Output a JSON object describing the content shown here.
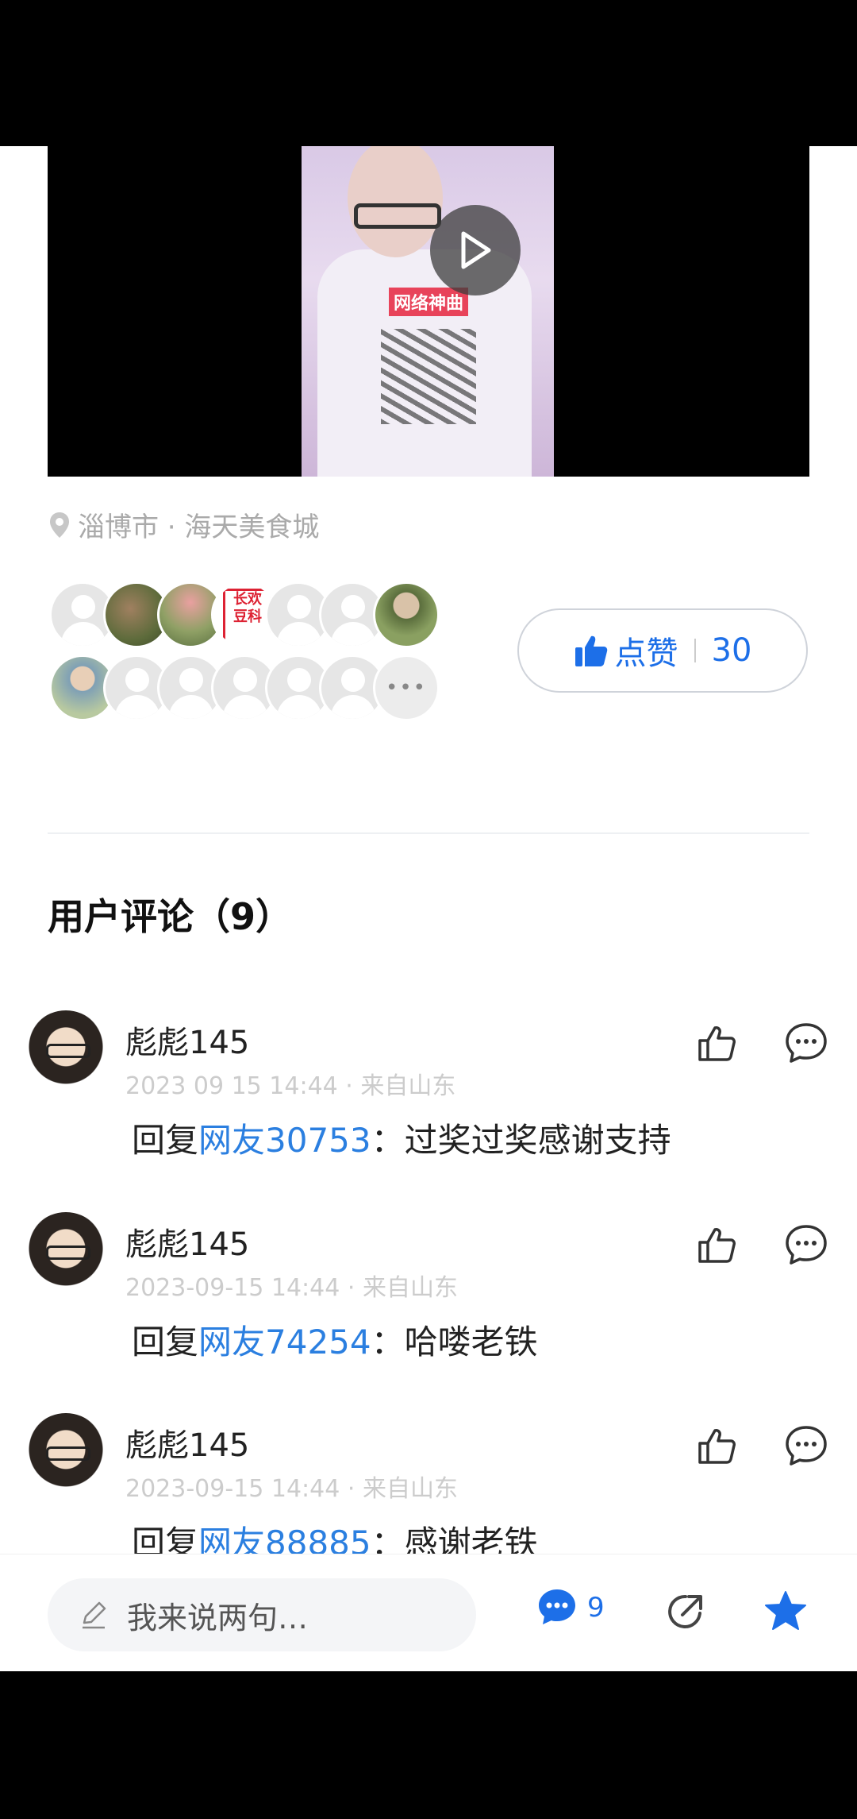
{
  "location": {
    "text": "淄博市 · 海天美食城"
  },
  "video": {
    "caption": "网络神曲"
  },
  "like": {
    "label": "点赞",
    "count": "30"
  },
  "comments": {
    "title": "用户评论（9）",
    "items": [
      {
        "name": "彪彪145",
        "meta": "2023 09 15  14:44 · 来自山东",
        "prefix": "回复",
        "mention": "网友30753",
        "body": "：过奖过奖感谢支持"
      },
      {
        "name": "彪彪145",
        "meta": "2023-09-15  14:44 · 来自山东",
        "prefix": "回复",
        "mention": "网友74254",
        "body": "：哈喽老铁"
      },
      {
        "name": "彪彪145",
        "meta": "2023-09-15  14:44 · 来自山东",
        "prefix": "回复",
        "mention": "网友88885",
        "body": "：感谢老铁"
      }
    ]
  },
  "bottom": {
    "placeholder": "我来说两句…",
    "comment_count": "9"
  },
  "colors": {
    "accent": "#1d6fe8",
    "mention": "#2b7fe0"
  }
}
